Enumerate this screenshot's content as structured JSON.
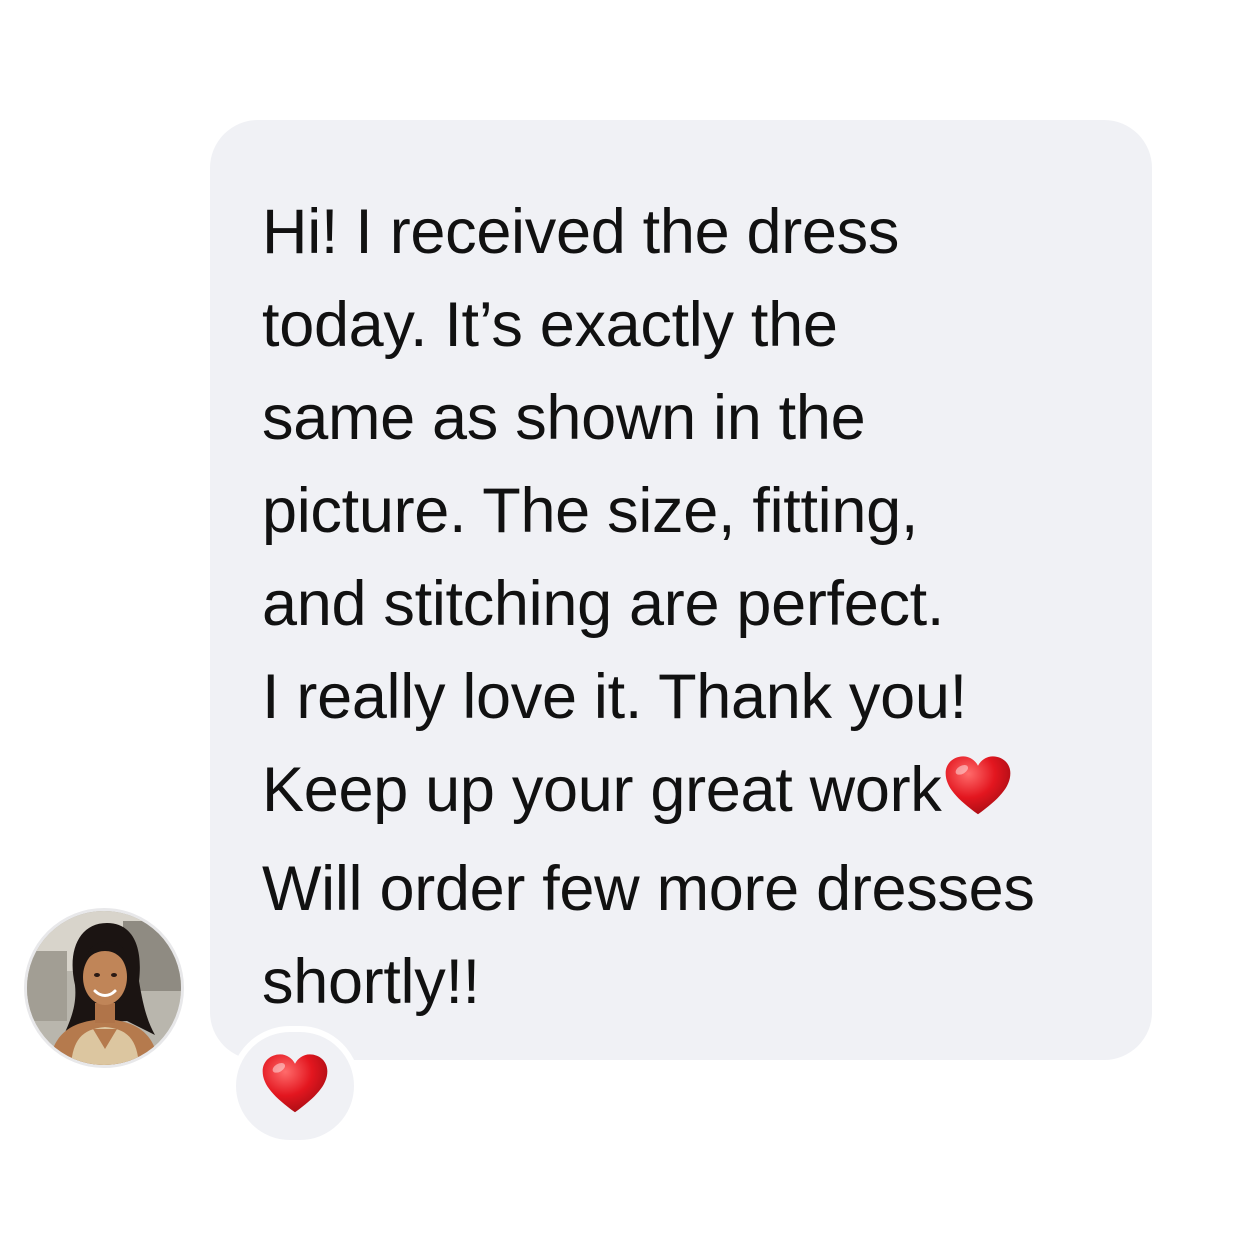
{
  "message": {
    "lines": [
      "Hi! I received the dress",
      "today. It’s exactly the",
      "same as shown in the",
      "picture. The size, fitting,",
      "and stitching are perfect.",
      "I really love it. Thank you!",
      "Keep up your great work",
      "Will order few more dresses",
      "shortly!!"
    ],
    "inline_emoji": "heart-icon",
    "bubble_color": "#f0f1f5",
    "text_color": "#111111"
  },
  "avatar": {
    "icon": "user-avatar-photo"
  },
  "reaction": {
    "icon": "heart-icon",
    "color": "#e0202a"
  }
}
